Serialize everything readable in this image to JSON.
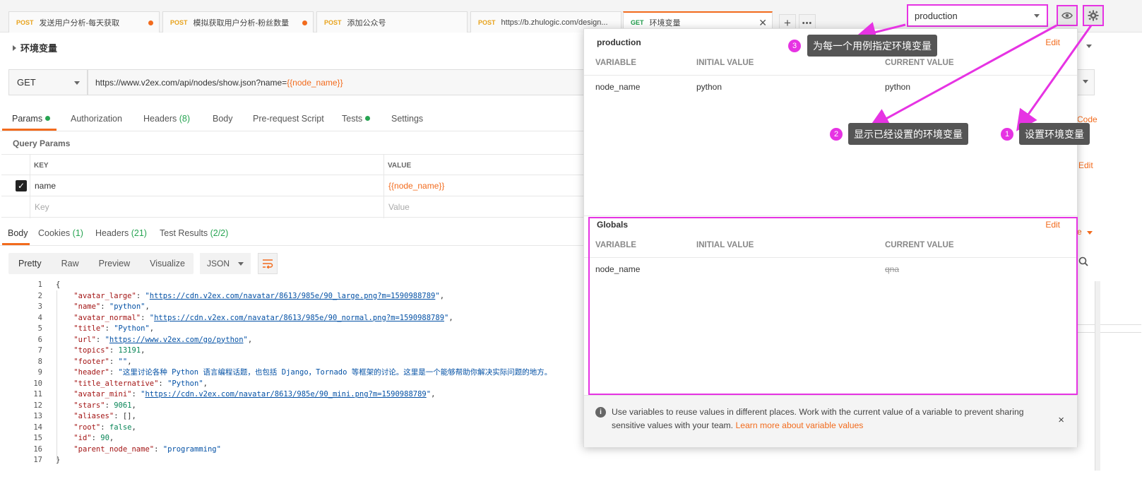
{
  "tabs": [
    {
      "method": "POST",
      "label": "发送用户分析-每天获取",
      "dirty": true
    },
    {
      "method": "POST",
      "label": "模拟获取用户分析-粉丝数量",
      "dirty": true
    },
    {
      "method": "POST",
      "label": "添加公众号",
      "dirty": false
    },
    {
      "method": "POST",
      "label": "https://b.zhulogic.com/design...",
      "dirty": false
    },
    {
      "method": "GET",
      "label": "环境变量",
      "active": true
    }
  ],
  "tab_actions": {
    "add": "+",
    "more": "•••"
  },
  "env": {
    "selected": "production"
  },
  "breadcrumb": "环境变量",
  "request": {
    "method": "GET",
    "url_prefix": "https://www.v2ex.com/api/nodes/show.json?name=",
    "url_var": "{{node_name}}"
  },
  "request_tabs": {
    "params": "Params",
    "authorization": "Authorization",
    "headers": "Headers",
    "headers_count": "(8)",
    "body": "Body",
    "prerequest": "Pre-request Script",
    "tests": "Tests",
    "settings": "Settings"
  },
  "query_params": {
    "title": "Query Params",
    "headers": {
      "key": "KEY",
      "value": "VALUE"
    },
    "rows": [
      {
        "key": "name",
        "value": "{{node_name}}",
        "checked": true
      }
    ],
    "placeholder": {
      "key": "Key",
      "value": "Value"
    }
  },
  "response_tabs": {
    "body": "Body",
    "cookies": "Cookies",
    "cookies_count": "(1)",
    "headers": "Headers",
    "headers_count": "(21)",
    "tests": "Test Results",
    "tests_count": "(2/2)"
  },
  "format_bar": {
    "pretty": "Pretty",
    "raw": "Raw",
    "preview": "Preview",
    "visualize": "Visualize",
    "lang": "JSON"
  },
  "code_lines": [
    {
      "n": "1",
      "parts": [
        [
          "p",
          "{"
        ]
      ]
    },
    {
      "n": "2",
      "parts": [
        [
          "p",
          "    "
        ],
        [
          "k",
          "\"avatar_large\""
        ],
        [
          "p",
          ": "
        ],
        [
          "s",
          "\""
        ],
        [
          "u",
          "https://cdn.v2ex.com/navatar/8613/985e/90_large.png?m=1590988789"
        ],
        [
          "s",
          "\""
        ],
        [
          "p",
          ","
        ]
      ]
    },
    {
      "n": "3",
      "parts": [
        [
          "p",
          "    "
        ],
        [
          "k",
          "\"name\""
        ],
        [
          "p",
          ": "
        ],
        [
          "s",
          "\"python\""
        ],
        [
          "p",
          ","
        ]
      ]
    },
    {
      "n": "4",
      "parts": [
        [
          "p",
          "    "
        ],
        [
          "k",
          "\"avatar_normal\""
        ],
        [
          "p",
          ": "
        ],
        [
          "s",
          "\""
        ],
        [
          "u",
          "https://cdn.v2ex.com/navatar/8613/985e/90_normal.png?m=1590988789"
        ],
        [
          "s",
          "\""
        ],
        [
          "p",
          ","
        ]
      ]
    },
    {
      "n": "5",
      "parts": [
        [
          "p",
          "    "
        ],
        [
          "k",
          "\"title\""
        ],
        [
          "p",
          ": "
        ],
        [
          "s",
          "\"Python\""
        ],
        [
          "p",
          ","
        ]
      ]
    },
    {
      "n": "6",
      "parts": [
        [
          "p",
          "    "
        ],
        [
          "k",
          "\"url\""
        ],
        [
          "p",
          ": "
        ],
        [
          "s",
          "\""
        ],
        [
          "u",
          "https://www.v2ex.com/go/python"
        ],
        [
          "s",
          "\""
        ],
        [
          "p",
          ","
        ]
      ]
    },
    {
      "n": "7",
      "parts": [
        [
          "p",
          "    "
        ],
        [
          "k",
          "\"topics\""
        ],
        [
          "p",
          ": "
        ],
        [
          "n",
          "13191"
        ],
        [
          "p",
          ","
        ]
      ]
    },
    {
      "n": "8",
      "parts": [
        [
          "p",
          "    "
        ],
        [
          "k",
          "\"footer\""
        ],
        [
          "p",
          ": "
        ],
        [
          "s",
          "\"\""
        ],
        [
          "p",
          ","
        ]
      ]
    },
    {
      "n": "9",
      "parts": [
        [
          "p",
          "    "
        ],
        [
          "k",
          "\"header\""
        ],
        [
          "p",
          ": "
        ],
        [
          "s",
          "\"这里讨论各种 Python 语言编程话题，也包括 Django，Tornado 等框架的讨论。这里是一个能够帮助你解决实际问题的地方。"
        ]
      ]
    },
    {
      "n": "10",
      "parts": [
        [
          "p",
          "    "
        ],
        [
          "k",
          "\"title_alternative\""
        ],
        [
          "p",
          ": "
        ],
        [
          "s",
          "\"Python\""
        ],
        [
          "p",
          ","
        ]
      ]
    },
    {
      "n": "11",
      "parts": [
        [
          "p",
          "    "
        ],
        [
          "k",
          "\"avatar_mini\""
        ],
        [
          "p",
          ": "
        ],
        [
          "s",
          "\""
        ],
        [
          "u",
          "https://cdn.v2ex.com/navatar/8613/985e/90_mini.png?m=1590988789"
        ],
        [
          "s",
          "\""
        ],
        [
          "p",
          ","
        ]
      ]
    },
    {
      "n": "12",
      "parts": [
        [
          "p",
          "    "
        ],
        [
          "k",
          "\"stars\""
        ],
        [
          "p",
          ": "
        ],
        [
          "n",
          "9061"
        ],
        [
          "p",
          ","
        ]
      ]
    },
    {
      "n": "13",
      "parts": [
        [
          "p",
          "    "
        ],
        [
          "k",
          "\"aliases\""
        ],
        [
          "p",
          ": [],"
        ]
      ]
    },
    {
      "n": "14",
      "parts": [
        [
          "p",
          "    "
        ],
        [
          "k",
          "\"root\""
        ],
        [
          "p",
          ": "
        ],
        [
          "n",
          "false"
        ],
        [
          "p",
          ","
        ]
      ]
    },
    {
      "n": "15",
      "parts": [
        [
          "p",
          "    "
        ],
        [
          "k",
          "\"id\""
        ],
        [
          "p",
          ": "
        ],
        [
          "n",
          "90"
        ],
        [
          "p",
          ","
        ]
      ]
    },
    {
      "n": "16",
      "parts": [
        [
          "p",
          "    "
        ],
        [
          "k",
          "\"parent_node_name\""
        ],
        [
          "p",
          ": "
        ],
        [
          "s",
          "\"programming\""
        ]
      ]
    },
    {
      "n": "17",
      "parts": [
        [
          "p",
          "}"
        ]
      ]
    }
  ],
  "bg_fragments": {
    "code": "Code",
    "edit": "Edit",
    "save": "e"
  },
  "env_popup": {
    "env_name": "production",
    "edit": "Edit",
    "columns": {
      "variable": "VARIABLE",
      "initial": "INITIAL VALUE",
      "current": "CURRENT VALUE"
    },
    "env_rows": [
      {
        "variable": "node_name",
        "initial": "python",
        "current": "python"
      }
    ],
    "globals_title": "Globals",
    "globals_edit": "Edit",
    "globals_rows": [
      {
        "variable": "node_name",
        "initial": "",
        "current": "qna"
      }
    ],
    "info_text": "Use variables to reuse values in different places. Work with the current value of a variable to prevent sharing sensitive values with your team.",
    "info_link": "Learn more about variable values",
    "close": "×"
  },
  "annotations": [
    {
      "num": "1",
      "text": "设置环境变量"
    },
    {
      "num": "2",
      "text": "显示已经设置的环境变量"
    },
    {
      "num": "3",
      "text": "为每一个用例指定环境变量"
    }
  ],
  "colors": {
    "accent": "#f26b1d",
    "highlight": "#e633e3",
    "success": "#27a452"
  }
}
